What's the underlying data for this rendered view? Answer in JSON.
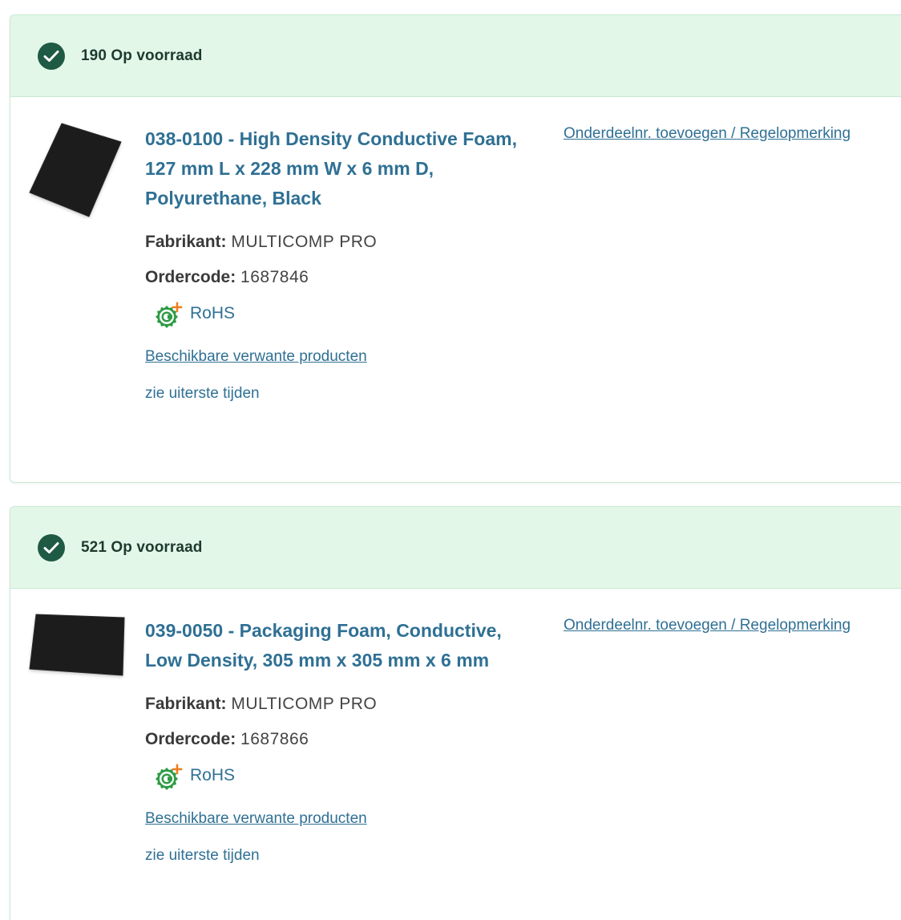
{
  "products": [
    {
      "stock_text": "190 Op voorraad",
      "title": "038-0100 - High Density Conductive Foam, 127 mm L x 228 mm W x 6 mm D, Polyurethane, Black",
      "title_lines": [
        "038-0100 - High Density Conductive Foam,",
        "127 mm L x 228 mm W x 6 mm D,",
        "Polyurethane, Black"
      ],
      "manufacturer_label": "Fabrikant:",
      "manufacturer": "MULTICOMP PRO",
      "ordercode_label": "Ordercode:",
      "ordercode": "1687846",
      "rohs_label": "RoHS",
      "related_link": "Beschikbare verwante producten",
      "deadline_link": "zie uiterste tijden",
      "add_part_link": "Onderdeelnr. toevoegen / Regelopmerking"
    },
    {
      "stock_text": "521 Op voorraad",
      "title": "039-0050 - Packaging Foam, Conductive, Low Density, 305 mm x 305 mm x 6 mm",
      "title_lines": [
        "039-0050 - Packaging Foam, Conductive,",
        "Low Density, 305 mm x 305 mm x 6 mm"
      ],
      "manufacturer_label": "Fabrikant:",
      "manufacturer": "MULTICOMP PRO",
      "ordercode_label": "Ordercode:",
      "ordercode": "1687866",
      "rohs_label": "RoHS",
      "related_link": "Beschikbare verwante producten",
      "deadline_link": "zie uiterste tijden",
      "add_part_link": "Onderdeelnr. toevoegen / Regelopmerking"
    }
  ],
  "colors": {
    "stock_bg": "#e3f7e8",
    "check_bg": "#1f5a45",
    "link": "#2f7094",
    "rohs_green": "#2e9c45",
    "rohs_orange": "#f07c1e"
  },
  "icons": {
    "stock": "check-circle-icon",
    "rohs": "rohs-compliant-icon",
    "thumbnail": "product-image"
  }
}
